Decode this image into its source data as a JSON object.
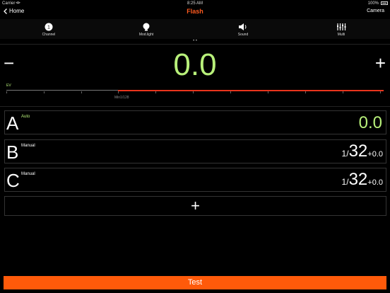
{
  "status": {
    "carrier": "Carrier",
    "time": "8:25 AM",
    "battery": "100%"
  },
  "nav": {
    "back_label": "Home",
    "title": "Flash",
    "right_label": "Camera"
  },
  "tabs": [
    {
      "label": "Channel",
      "icon": "channel-1-icon",
      "badge": "1"
    },
    {
      "label": "Mod.light",
      "icon": "bulb-icon"
    },
    {
      "label": "Sound",
      "icon": "speaker-icon"
    },
    {
      "label": "Multi",
      "icon": "multi-flash-icon"
    }
  ],
  "page_dots": "• •",
  "ev": {
    "value": "0.0",
    "label": "EV",
    "minus": "−",
    "plus": "+",
    "min_label": "Min1/128"
  },
  "groups": [
    {
      "letter": "A",
      "mode": "Auto",
      "value": "0.0"
    },
    {
      "letter": "B",
      "mode": "Manual",
      "numerator": "1",
      "slash": "/",
      "denominator": "32",
      "offset": "+0.0"
    },
    {
      "letter": "C",
      "mode": "Manual",
      "numerator": "1",
      "slash": "/",
      "denominator": "32",
      "offset": "+0.0"
    }
  ],
  "add_label": "+",
  "test_label": "Test",
  "colors": {
    "accent": "#ff5a0a",
    "value_green": "#b8f07a",
    "scale_red": "#e8341c"
  }
}
